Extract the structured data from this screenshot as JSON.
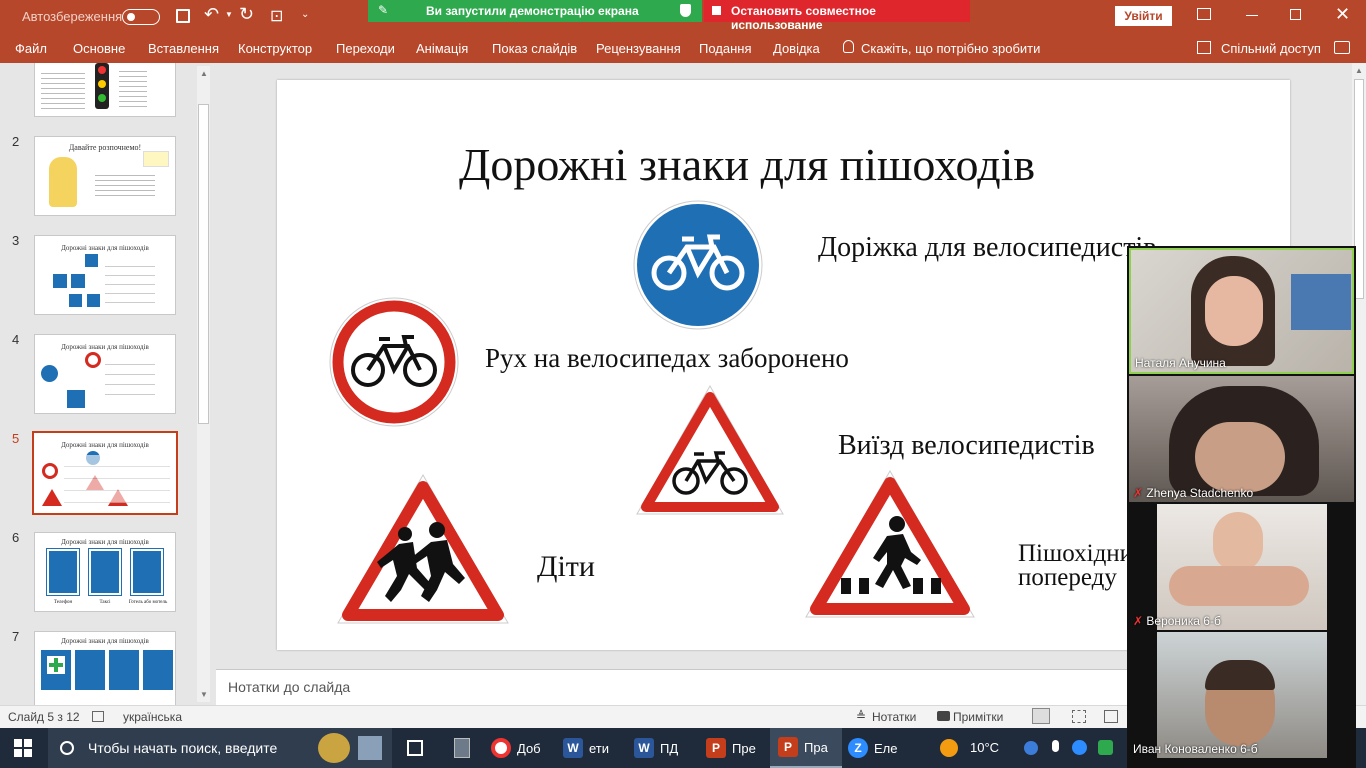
{
  "app": {
    "autosave_label": "Автозбереження",
    "share_banner": "Ви запустили демонстрацію екрана",
    "stop_share": "Остановить совместное использование",
    "signin": "Увійти"
  },
  "menu": [
    "Файл",
    "Основне",
    "Вставлення",
    "Конструктор",
    "Переходи",
    "Анімація",
    "Показ слайдів",
    "Рецензування",
    "Подання",
    "Довідка",
    "Скажіть, що потрібно зробити"
  ],
  "share_label": "Спільний доступ",
  "thumbnails": {
    "numbers": [
      "2",
      "3",
      "4",
      "5",
      "6",
      "7"
    ],
    "t2_title": "Давайте розпочнемо!",
    "t3_title": "Дорожні знаки для пішоходів",
    "t4_title": "Дорожні знаки для пішоходів",
    "t5_title": "Дорожні знаки для пішоходів",
    "t6_title": "Дорожні знаки для пішоходів",
    "t6_labels": [
      "Телефон",
      "Таксі",
      "Готель або мотель"
    ],
    "t7_title": "Дорожні знаки для пішоходів"
  },
  "slide": {
    "title": "Дорожні знаки для пішоходів",
    "bike_path": "Доріжка для велосипедистів",
    "no_bikes": "Рух на велосипедах заборонено",
    "cyclists_exit": "Виїзд велосипедистів",
    "children": "Діти",
    "pedestrian_l1": "Пішохідний перехід",
    "pedestrian_l2": "попереду"
  },
  "notes_placeholder": "Нотатки до слайда",
  "status": {
    "slide_counter": "Слайд 5 з 12",
    "language": "українська",
    "notes": "Нотатки",
    "comments": "Примітки"
  },
  "taskbar": {
    "search": "Чтобы начать поиск, введите",
    "apps": [
      "Доб",
      "ети",
      "ПД",
      "Пре",
      "Пра",
      "Еле"
    ],
    "temperature": "10°C"
  },
  "participants": [
    "Наталя Анучина",
    "Zhenya Stadchenko",
    "Вероника 6-б",
    "Иван Коноваленко 6-б"
  ],
  "colors": {
    "accent": "#b7472a",
    "sign_red": "#d42a20",
    "sign_blue": "#1f6fb5",
    "share_green": "#2ea94e"
  }
}
